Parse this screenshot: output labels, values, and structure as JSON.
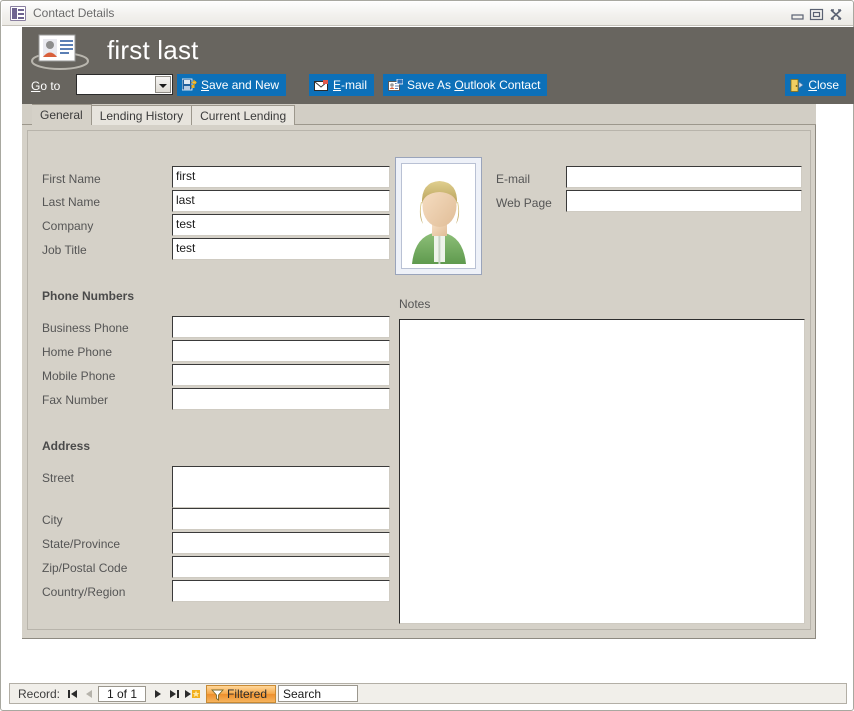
{
  "window": {
    "title": "Contact Details",
    "icon": "form-icon",
    "controls": {
      "minimize": "Minimize",
      "restore": "Restore",
      "close": "Close"
    }
  },
  "header": {
    "icon": "contact-card-icon",
    "record_title": "first last",
    "goto_label_pre": "G",
    "goto_label_accel": "o",
    "goto_label_post": " to",
    "goto_value": "",
    "buttons": {
      "save_and_new": {
        "pre": "",
        "accel": "S",
        "post": "ave and New",
        "icon": "save-new-icon"
      },
      "email": {
        "pre": "",
        "accel": "E",
        "post": "-mail",
        "icon": "email-icon"
      },
      "save_as_outlook": {
        "pre": "Save As ",
        "accel": "O",
        "post": "utlook Contact",
        "icon": "outlook-contact-icon"
      },
      "close": {
        "pre": "",
        "accel": "C",
        "post": "lose",
        "icon": "door-exit-icon"
      }
    }
  },
  "tabs": [
    {
      "label": "General",
      "active": true
    },
    {
      "label": "Lending History",
      "active": false
    },
    {
      "label": "Current Lending",
      "active": false
    }
  ],
  "form": {
    "left_fields": [
      {
        "label": "First Name",
        "value": "first"
      },
      {
        "label": "Last Name",
        "value": "last"
      },
      {
        "label": "Company",
        "value": "test"
      },
      {
        "label": "Job Title",
        "value": "test"
      }
    ],
    "phone_section": "Phone Numbers",
    "phone_fields": [
      {
        "label": "Business Phone",
        "value": ""
      },
      {
        "label": "Home Phone",
        "value": ""
      },
      {
        "label": "Mobile Phone",
        "value": ""
      },
      {
        "label": "Fax Number",
        "value": ""
      }
    ],
    "address_section": "Address",
    "address_fields": [
      {
        "label": "Street",
        "value": ""
      },
      {
        "label": "City",
        "value": ""
      },
      {
        "label": "State/Province",
        "value": ""
      },
      {
        "label": "Zip/Postal Code",
        "value": ""
      },
      {
        "label": "Country/Region",
        "value": ""
      }
    ],
    "right_fields": [
      {
        "label": "E-mail",
        "value": ""
      },
      {
        "label": "Web Page",
        "value": ""
      }
    ],
    "photo": "contact-photo-placeholder",
    "notes_label": "Notes",
    "notes_value": ""
  },
  "statusbar": {
    "record_label": "Record:",
    "counter": "1 of 1",
    "filter_label": "Filtered",
    "search_value": "Search",
    "nav": {
      "first": "First record",
      "previous": "Previous record",
      "next": "Next record",
      "last": "Last record",
      "new": "New (blank) record"
    }
  },
  "colors": {
    "header_band": "#68655f",
    "form_background": "#d5d1c8",
    "command_button": "#0d70b8",
    "filter_accent": "#f6a94c",
    "title_text": "#ffffff"
  }
}
